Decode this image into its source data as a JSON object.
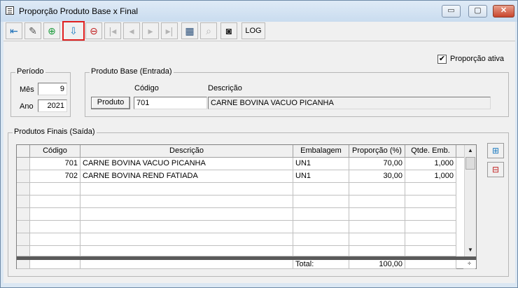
{
  "window": {
    "title": "Proporção Produto Base x Final",
    "minimize_glyph": "▭",
    "maximize_glyph": "▢",
    "close_glyph": "✕"
  },
  "toolbar": {
    "buttons": [
      {
        "name": "exit",
        "icon": "exit-door-icon",
        "glyph": "⇤"
      },
      {
        "name": "edit",
        "icon": "eraser-icon",
        "glyph": "✎"
      },
      {
        "name": "add",
        "icon": "add-record-icon",
        "glyph": "⊕"
      },
      {
        "name": "save",
        "icon": "save-record-icon",
        "glyph": "⇩",
        "selected": true
      },
      {
        "name": "delete",
        "icon": "delete-record-icon",
        "glyph": "⊖"
      },
      {
        "name": "first",
        "icon": "first-record-icon",
        "glyph": "|◂",
        "disabled": true
      },
      {
        "name": "prev",
        "icon": "previous-record-icon",
        "glyph": "◂",
        "disabled": true
      },
      {
        "name": "next",
        "icon": "next-record-icon",
        "glyph": "▸",
        "disabled": true
      },
      {
        "name": "last",
        "icon": "last-record-icon",
        "glyph": "▸|",
        "disabled": true
      },
      {
        "name": "list",
        "icon": "grid-list-icon",
        "glyph": "▦"
      },
      {
        "name": "search",
        "icon": "binoculars-icon",
        "glyph": "⌕",
        "disabled": true
      },
      {
        "name": "camera",
        "icon": "camera-icon",
        "glyph": "◙"
      }
    ],
    "log_label": "LOG"
  },
  "proporcao_ativa": {
    "label": "Proporção ativa",
    "checked": true,
    "check_glyph": "✔"
  },
  "periodo": {
    "legend": "Período",
    "mes_label": "Mês",
    "mes_value": "9",
    "ano_label": "Ano",
    "ano_value": "2021"
  },
  "produto_base": {
    "legend": "Produto Base (Entrada)",
    "codigo_header": "Código",
    "descricao_header": "Descrição",
    "produto_button": "Produto",
    "codigo_value": "701",
    "descricao_value": "CARNE BOVINA VACUO PICANHA"
  },
  "produtos_finais": {
    "legend": "Produtos Finais (Saída)",
    "columns": [
      "Código",
      "Descrição",
      "Embalagem",
      "Proporção (%)",
      "Qtde. Emb."
    ],
    "rows": [
      {
        "codigo": "701",
        "descricao": "CARNE BOVINA VACUO PICANHA",
        "embalagem": "UN1",
        "proporcao": "70,00",
        "qtde": "1,000"
      },
      {
        "codigo": "702",
        "descricao": "CARNE BOVINA REND FATIADA",
        "embalagem": "UN1",
        "proporcao": "30,00",
        "qtde": "1,000"
      }
    ],
    "total_label": "Total:",
    "total_value": "100,00",
    "scroll_up_glyph": "▲",
    "scroll_down_glyph": "▼",
    "spin_glyph": "÷",
    "add_row_icon": "add-row-icon",
    "add_row_glyph": "⊞",
    "remove_row_icon": "remove-row-icon",
    "remove_row_glyph": "⊟"
  }
}
